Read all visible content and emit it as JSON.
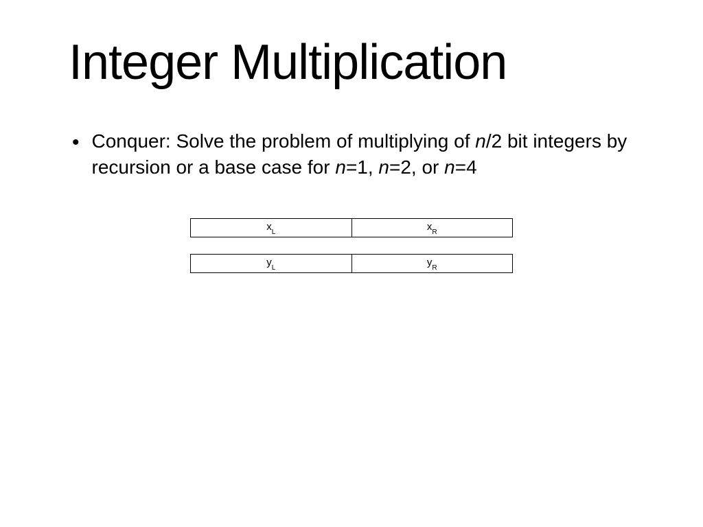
{
  "title": "Integer Multiplication",
  "bullet": {
    "pre": "Conquer: Solve the problem of multiplying of ",
    "n1": "n",
    "mid1": "/2 bit integers by recursion or a base case for ",
    "n2": "n",
    "mid2": "=1, ",
    "n3": "n",
    "mid3": "=2, or ",
    "n4": "n",
    "mid4": "=4"
  },
  "diagram": {
    "row1": {
      "left_var": "x",
      "left_sub": "L",
      "right_var": "x",
      "right_sub": "R"
    },
    "row2": {
      "left_var": "y",
      "left_sub": "L",
      "right_var": "y",
      "right_sub": "R"
    }
  }
}
